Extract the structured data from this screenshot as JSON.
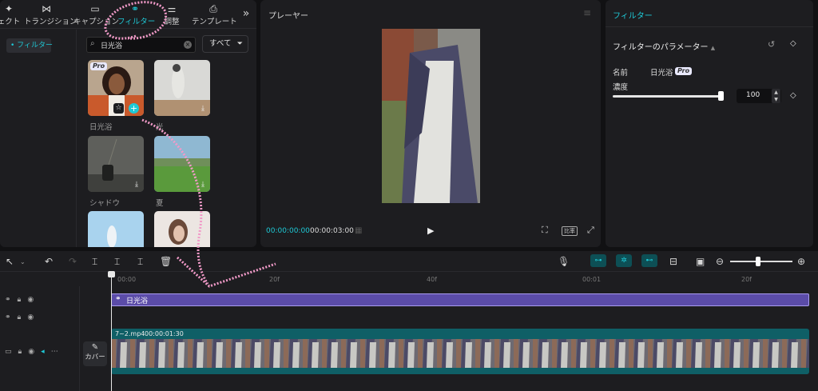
{
  "left_panel": {
    "tabs": [
      {
        "label": "ェクト",
        "icon": "effects-icon"
      },
      {
        "label": "トランジション",
        "icon": "transition-icon"
      },
      {
        "label": "キャプション",
        "icon": "caption-icon"
      },
      {
        "label": "フィルター",
        "icon": "filter-icon",
        "active": true
      },
      {
        "label": "調整",
        "icon": "adjust-icon"
      },
      {
        "label": "テンプレート",
        "icon": "template-icon"
      }
    ],
    "more": "»",
    "sidebar_item": "• フィルター",
    "search_value": "日光浴",
    "filter_all_label": "すべて",
    "pro_badge": "Pro",
    "thumbnails": [
      {
        "label": "日光浴"
      },
      {
        "label": "光"
      },
      {
        "label": "シャドウ"
      },
      {
        "label": "夏"
      },
      {
        "label": ""
      },
      {
        "label": ""
      }
    ]
  },
  "player": {
    "title": "プレーヤー",
    "current_time": "00:00:00:00",
    "total_time": "00:00:03:00",
    "ratio_label": "比率"
  },
  "inspector": {
    "title": "フィルター",
    "params_title": "フィルターのパラメーター",
    "name_label": "名前",
    "name_value": "日光浴",
    "pro_badge": "Pro",
    "strength_label": "濃度",
    "strength_value": "100",
    "strength_level_percent": 100
  },
  "timeline": {
    "ruler": [
      "00:00",
      "20f",
      "40f",
      "00:01",
      "20f"
    ],
    "filter_clip_label": "日光浴",
    "video_clip_name": "7~2.mp4",
    "video_clip_duration": "00:00:01:30",
    "cover_label": "カバー"
  },
  "colors": {
    "accent": "#1ec9d6",
    "filter_clip": "#5b4ca8",
    "video_clip": "#0f5f66",
    "annotation_pink": "#f19ac8"
  }
}
